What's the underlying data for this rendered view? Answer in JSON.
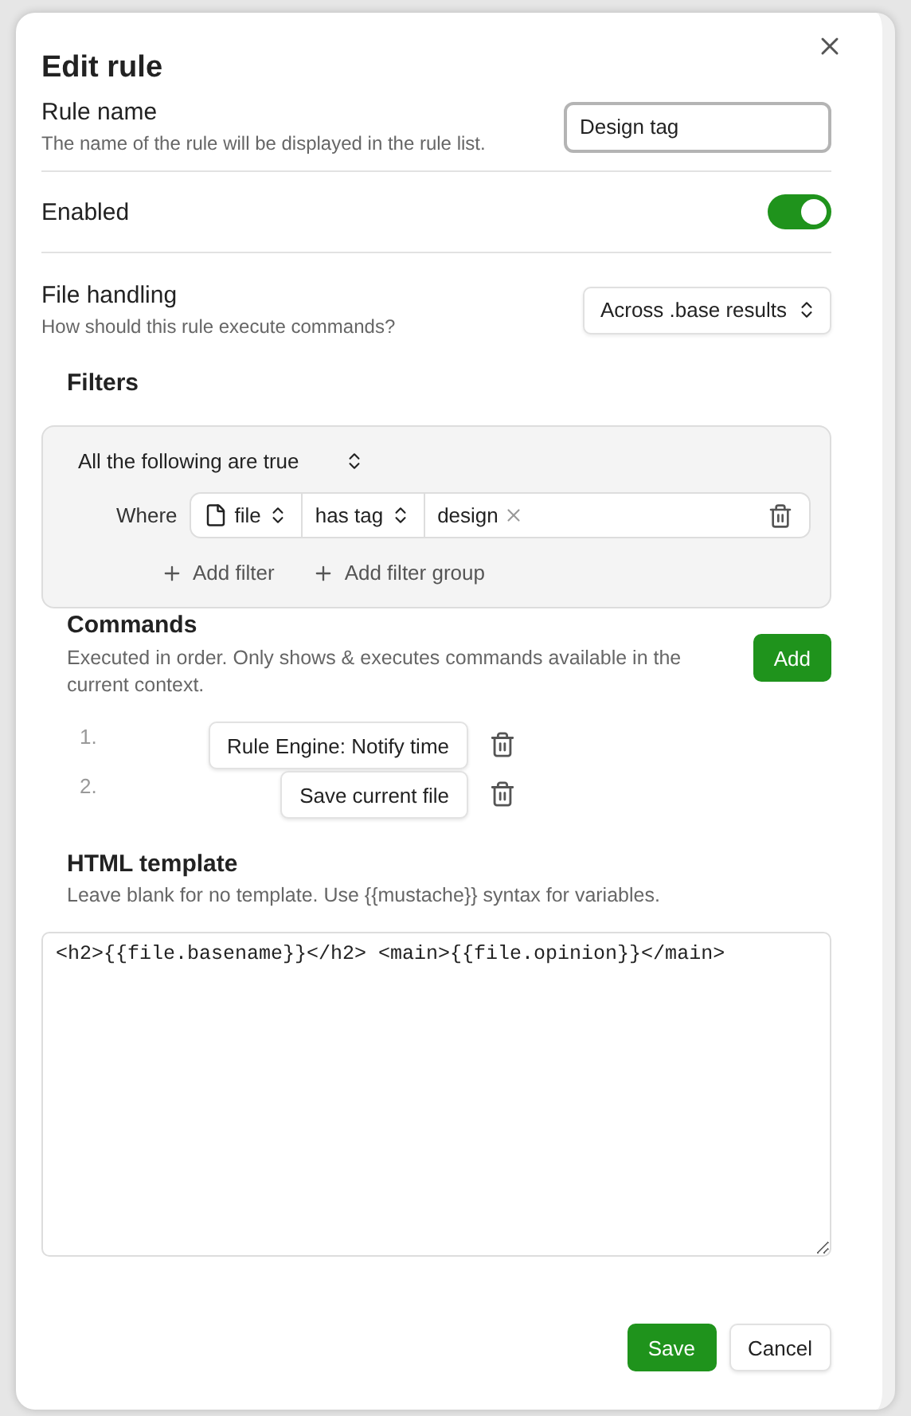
{
  "dialog": {
    "title": "Edit rule"
  },
  "rule_name": {
    "label": "Rule name",
    "description": "The name of the rule will be displayed in the rule list.",
    "value": "Design tag"
  },
  "enabled": {
    "label": "Enabled",
    "on": true
  },
  "file_handling": {
    "label": "File handling",
    "description": "How should this rule execute commands?",
    "value": "Across .base results"
  },
  "filters": {
    "title": "Filters",
    "group_mode": "All the following are true",
    "conditions": [
      {
        "prefix": "Where",
        "property": "file",
        "operator": "has tag",
        "values": [
          "design"
        ]
      }
    ],
    "add_filter": "Add filter",
    "add_filter_group": "Add filter group"
  },
  "commands": {
    "title": "Commands",
    "description": "Executed in order. Only shows & executes commands available in the current context.",
    "add_button": "Add",
    "items": [
      {
        "number": "1.",
        "name": "Rule Engine: Notify time"
      },
      {
        "number": "2.",
        "name": "Save current file"
      }
    ]
  },
  "html_template": {
    "title": "HTML template",
    "description": "Leave blank for no template. Use {{mustache}} syntax for variables.",
    "value": "<h2>{{file.basename}}</h2> <main>{{file.opinion}}</main>"
  },
  "footer": {
    "save": "Save",
    "cancel": "Cancel"
  }
}
